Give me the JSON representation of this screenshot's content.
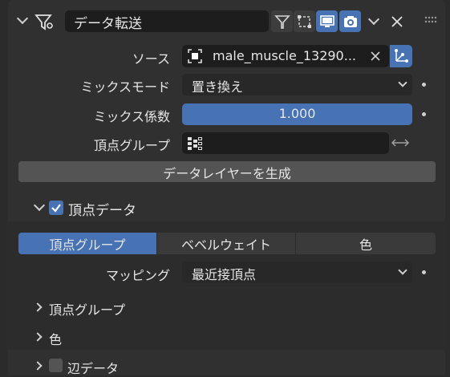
{
  "header": {
    "modifier_name": "データ転送",
    "icons": [
      "chevron-down-icon",
      "data-transfer-icon",
      "filter-icon",
      "editmode-icon",
      "monitor-icon",
      "camera-icon",
      "dropdown-icon",
      "close-icon",
      "drag-handle-icon"
    ]
  },
  "source": {
    "label": "ソース",
    "value": "male_muscle_13290..."
  },
  "mix_mode": {
    "label": "ミックスモード",
    "value": "置き換え"
  },
  "mix_factor": {
    "label": "ミックス係数",
    "value": "1.000"
  },
  "vertex_group": {
    "label": "頂点グループ",
    "value": ""
  },
  "generate_button": "データレイヤーを生成",
  "vertex_data": {
    "label": "頂点データ",
    "checked": true,
    "tabs": [
      {
        "label": "頂点グループ",
        "active": true
      },
      {
        "label": "ベベルウェイト",
        "active": false
      },
      {
        "label": "色",
        "active": false
      }
    ],
    "mapping": {
      "label": "マッピング",
      "value": "最近接頂点"
    },
    "subpanels": [
      "頂点グループ",
      "色"
    ]
  },
  "edge_data": {
    "label": "辺データ",
    "checked": false
  },
  "colors": {
    "accent": "#4772b3",
    "panel": "#303030",
    "field": "#1d1d1d"
  }
}
